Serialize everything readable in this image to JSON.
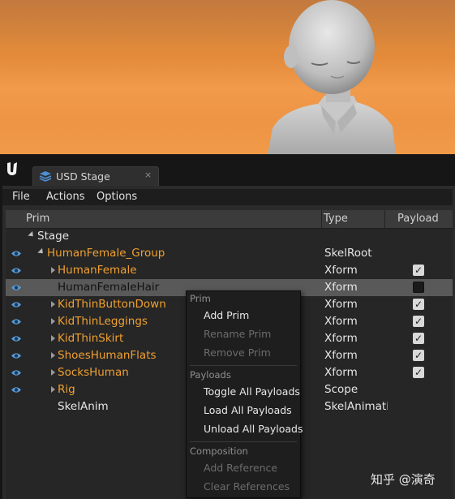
{
  "tab": {
    "label": "USD Stage",
    "close": "×"
  },
  "menu": {
    "file": "File",
    "actions": "Actions",
    "options": "Options"
  },
  "columns": {
    "prim": "Prim",
    "type": "Type",
    "payload": "Payload"
  },
  "tree": {
    "stage": "Stage",
    "rows": [
      {
        "name": "HumanFemale_Group",
        "type": "SkelRoot",
        "payload": null
      },
      {
        "name": "HumanFemale",
        "type": "Xform",
        "payload": true
      },
      {
        "name": "HumanFemaleHair",
        "type": "Xform",
        "payload": false
      },
      {
        "name": "KidThinButtonDown",
        "type": "Xform",
        "payload": true
      },
      {
        "name": "KidThinLeggings",
        "type": "Xform",
        "payload": true
      },
      {
        "name": "KidThinSkirt",
        "type": "Xform",
        "payload": true
      },
      {
        "name": "ShoesHumanFlats",
        "type": "Xform",
        "payload": true
      },
      {
        "name": "SocksHuman",
        "type": "Xform",
        "payload": true
      },
      {
        "name": "Rig",
        "type": "Scope",
        "payload": null
      },
      {
        "name": "SkelAnim",
        "type": "SkelAnimation",
        "payload": null
      }
    ]
  },
  "context_menu": {
    "prim_header": "Prim",
    "add_prim": "Add Prim",
    "rename_prim": "Rename Prim",
    "remove_prim": "Remove Prim",
    "payloads_header": "Payloads",
    "toggle_all": "Toggle All Payloads",
    "load_all": "Load All Payloads",
    "unload_all": "Unload All Payloads",
    "composition_header": "Composition",
    "add_reference": "Add Reference",
    "clear_references": "Clear References"
  },
  "watermark": "知乎 @演奇",
  "colors": {
    "prim_orange": "#f0a030",
    "selected_row": "#595959",
    "eye": "#5a9bd4"
  }
}
